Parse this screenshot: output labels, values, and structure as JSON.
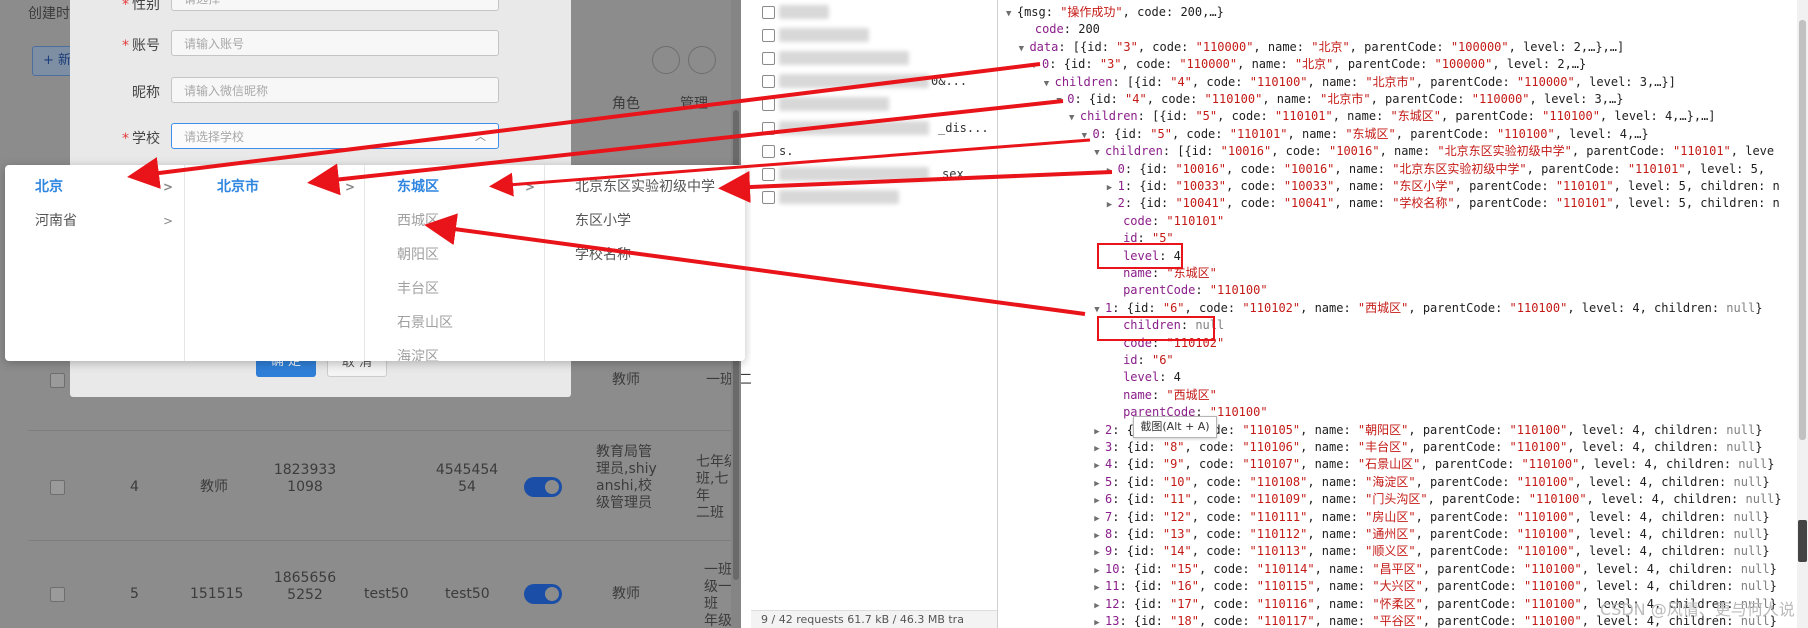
{
  "left_page": {
    "filter_label": "创建时",
    "add_button": "+ 新",
    "columns": {
      "role": "角色",
      "admin": "管理"
    },
    "rows": [
      {
        "role_partial": "教师",
        "class_partial": "一班,二"
      },
      {
        "index": "4",
        "type": "教师",
        "account": "1823933\n1098",
        "nickname": "",
        "school": "4545454\n54",
        "role": "教育局管\n理员,shiy\nanshi,校\n级管理员",
        "class_partial": "七年级\n班,七年\n二班"
      },
      {
        "index": "5",
        "type": "151515",
        "account": "1865656\n5252",
        "nickname": "test50",
        "school": "test50",
        "role": "教师",
        "class_partial": "一班,\n级一班\n年级二"
      }
    ]
  },
  "dialog": {
    "fields": [
      {
        "label": "性别",
        "placeholder": "请选择",
        "required": true
      },
      {
        "label": "账号",
        "placeholder": "请输入账号",
        "required": true
      },
      {
        "label": "昵称",
        "placeholder": "请输入微信昵称",
        "required": false
      },
      {
        "label": "学校",
        "placeholder": "请选择学校",
        "required": true
      }
    ],
    "ok_label": "确 定",
    "cancel_label": "取 消"
  },
  "cascader": {
    "col1": [
      "北京",
      "河南省"
    ],
    "col2": [
      "北京市"
    ],
    "col3": [
      "东城区",
      "西城区",
      "朝阳区",
      "丰台区",
      "石景山区",
      "海淀区"
    ],
    "col4": [
      "北京东区实验初级中学",
      "东区小学",
      "学校名称"
    ]
  },
  "network": {
    "fragments": [
      "0&...",
      "_dis...",
      "s.",
      "sex"
    ],
    "status": "9 / 42 requests    61.7 kB / 46.3 MB tra"
  },
  "preview": {
    "lines": [
      "{msg: \"操作成功\", code: 200,…}",
      "code: 200",
      "data: [{id: \"3\", code: \"110000\", name: \"北京\", parentCode: \"100000\", level: 2,…},…]",
      "0: {id: \"3\", code: \"110000\", name: \"北京\", parentCode: \"100000\", level: 2,…}",
      "children: [{id: \"4\", code: \"110100\", name: \"北京市\", parentCode: \"110000\", level: 3,…}]",
      "0: {id: \"4\", code: \"110100\", name: \"北京市\", parentCode: \"110000\", level: 3,…}",
      "children: [{id: \"5\", code: \"110101\", name: \"东城区\", parentCode: \"110100\", level: 4,…},…]",
      "0: {id: \"5\", code: \"110101\", name: \"东城区\", parentCode: \"110100\", level: 4,…}",
      "children: [{id: \"10016\", code: \"10016\", name: \"北京东区实验初级中学\", parentCode: \"110101\", leve",
      "0: {id: \"10016\", code: \"10016\", name: \"北京东区实验初级中学\", parentCode: \"110101\", level: 5,",
      "1: {id: \"10033\", code: \"10033\", name: \"东区小学\", parentCode: \"110101\", level: 5, children: n",
      "2: {id: \"10041\", code: \"10041\", name: \"学校名称\", parentCode: \"110101\", level: 5, children: n",
      "code: \"110101\"",
      "id: \"5\"",
      "level: 4",
      "name: \"东城区\"",
      "parentCode: \"110100\"",
      "1: {id: \"6\", code: \"110102\", name: \"西城区\", parentCode: \"110100\", level: 4, children: null}",
      "children: null",
      "code: \"110102\"",
      "id: \"6\"",
      "level: 4",
      "name: \"西城区\"",
      "parentCode: \"110100\"",
      "2: {id: \"7\", code: \"110105\", name: \"朝阳区\", parentCode: \"110100\", level: 4, children: null}",
      "3: {id: \"8\", code: \"110106\", name: \"丰台区\", parentCode: \"110100\", level: 4, children: null}",
      "4: {id: \"9\", code: \"110107\", name: \"石景山区\", parentCode: \"110100\", level: 4, children: null}",
      "5: {id: \"10\", code: \"110108\", name: \"海淀区\", parentCode: \"110100\", level: 4, children: null}",
      "6: {id: \"11\", code: \"110109\", name: \"门头沟区\", parentCode: \"110100\", level: 4, children: null}",
      "7: {id: \"12\", code: \"110111\", name: \"房山区\", parentCode: \"110100\", level: 4, children: null}",
      "8: {id: \"13\", code: \"110112\", name: \"通州区\", parentCode: \"110100\", level: 4, children: null}",
      "9: {id: \"14\", code: \"110113\", name: \"顺义区\", parentCode: \"110100\", level: 4, children: null}",
      "10: {id: \"15\", code: \"110114\", name: \"昌平区\", parentCode: \"110100\", level: 4, children: null}",
      "11: {id: \"16\", code: \"110115\", name: \"大兴区\", parentCode: \"110100\", level: 4, children: null}",
      "12: {id: \"17\", code: \"110116\", name: \"怀柔区\", parentCode: \"110100\", level: 4, children: null}",
      "13: {id: \"18\", code: \"110117\", name: \"平谷区\", parentCode: \"110100\", level: 4, children: null}"
    ],
    "tooltip": "截图(Alt + A)",
    "watermark": "CSDN @风情、更与何人说"
  },
  "colors": {
    "accent": "#2f86e0",
    "annotation_red": "#e8141a",
    "json_key": "#8a1e8a",
    "json_string": "#c41a16"
  }
}
